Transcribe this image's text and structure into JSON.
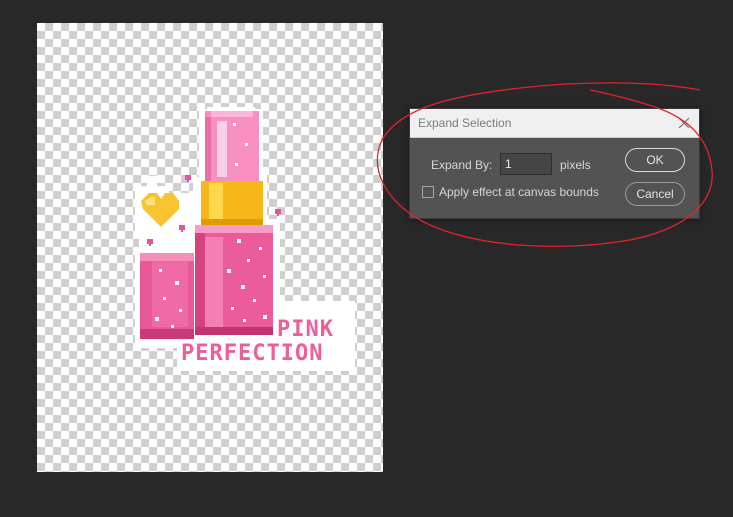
{
  "dialog": {
    "title": "Expand Selection",
    "expand_label": "Expand By:",
    "expand_value": "1",
    "unit": "pixels",
    "checkbox_label": "Apply effect at canvas bounds",
    "checkbox_checked": false,
    "ok_label": "OK",
    "cancel_label": "Cancel"
  },
  "artwork": {
    "line1": "PINK",
    "line2": "PERFECTION"
  },
  "annotation": {
    "color": "#e0242b"
  },
  "colors": {
    "workspace": "#282828",
    "dialog": "#535353",
    "titlebar": "#f0f0f0",
    "pink": "#ec5f9b",
    "gold": "#f5c518"
  },
  "icons": {
    "close": "close-icon"
  }
}
